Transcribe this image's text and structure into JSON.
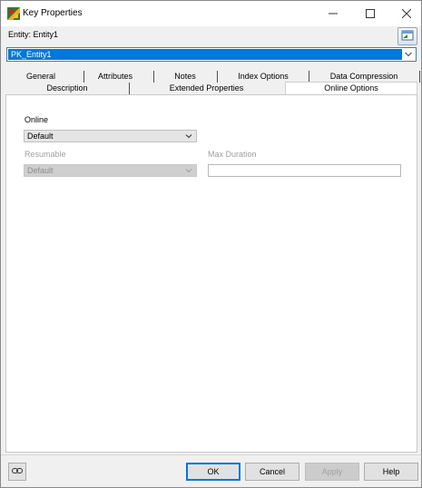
{
  "window": {
    "title": "Key Properties",
    "controls": {
      "minimize_icon": "minimize-icon",
      "maximize_icon": "maximize-icon",
      "close_icon": "close-icon"
    }
  },
  "entity": {
    "label": "Entity: Entity1",
    "button_icon": "entity-properties-icon"
  },
  "key_select": {
    "value": "PK_Entity1"
  },
  "tabs": {
    "row1": [
      "General",
      "Attributes",
      "Notes",
      "Index Options",
      "Data Compression"
    ],
    "row2": [
      "Description",
      "Extended Properties",
      "Online Options"
    ],
    "active": "Online Options"
  },
  "online_options": {
    "online": {
      "label": "Online",
      "value": "Default"
    },
    "resumable": {
      "label": "Resumable",
      "value": "Default",
      "disabled": true
    },
    "max_duration": {
      "label": "Max Duration",
      "value": "",
      "disabled": true
    }
  },
  "footer": {
    "link_icon": "link-icon",
    "buttons": {
      "ok": "OK",
      "cancel": "Cancel",
      "apply": "Apply",
      "help": "Help"
    }
  },
  "colors": {
    "accent": "#0078d7",
    "panel_bg": "#ffffff",
    "dialog_bg": "#f0f0f0"
  }
}
